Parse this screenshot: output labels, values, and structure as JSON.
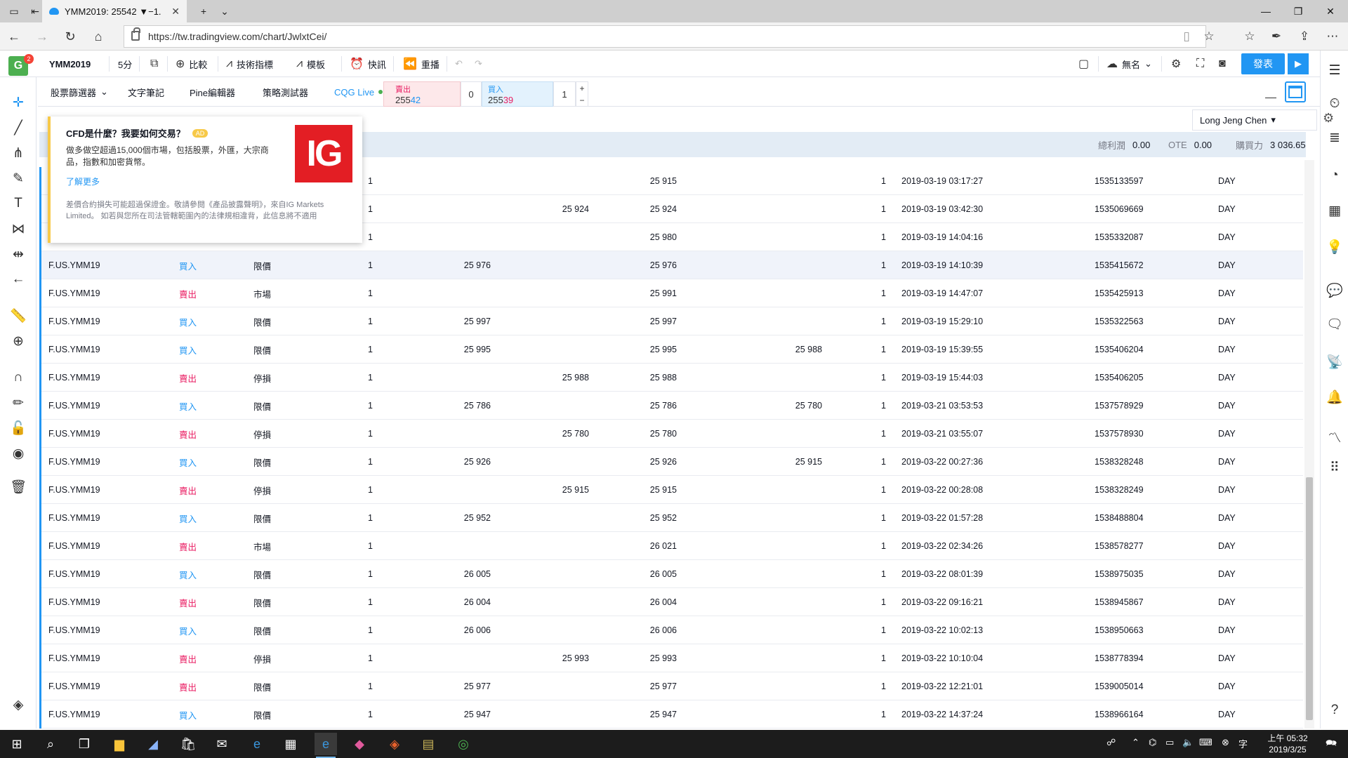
{
  "browser": {
    "tab_title": "YMM2019: 25542 ▼−1.",
    "url": "https://tw.tradingview.com/chart/JwlxtCei/"
  },
  "toolbar": {
    "symbol": "YMM2019",
    "interval": "5分",
    "compare": "比較",
    "indicators": "技術指標",
    "templates": "模板",
    "alert": "快訊",
    "replay": "重播",
    "layout_name": "無名",
    "publish": "發表"
  },
  "logo": {
    "letter": "G",
    "badge": "2"
  },
  "panel": {
    "tabs": [
      "股票篩選器",
      "文字筆記",
      "Pine編輯器",
      "策略測試器",
      "CQG Live"
    ],
    "sell_label": "賣出",
    "sell_price_a": "255",
    "sell_price_b": "42",
    "spread": "0",
    "buy_label": "買入",
    "buy_price_a": "255",
    "buy_price_b": "39",
    "qty": "1",
    "plus": "+",
    "minus": "−"
  },
  "account": {
    "name": "Long Jeng Chen",
    "total_pl_label": "總利潤",
    "total_pl": "0.00",
    "ote_label": "OTE",
    "ote": "0.00",
    "buying_power_label": "購買力",
    "buying_power": "3 036.65"
  },
  "ad": {
    "title": "CFD是什麼？我要如何交易？",
    "badge": "AD",
    "body": "做多做空超過15,000個市場，包括股票，外匯，大宗商品，指數和加密貨幣。",
    "link": "了解更多",
    "note": "差價合約損失可能超過保證金。敬請參閱《產品披露聲明》，來自IG Markets Limited。 如若與您所在司法管轄範圍內的法律規相違背，此信息將不適用",
    "logo_text": "IG"
  },
  "orders": [
    {
      "symbol": "",
      "side": "",
      "type": "",
      "qty": "1",
      "limit": "",
      "stop": "",
      "fill": "25 915",
      "tp": "",
      "fqty": "1",
      "time": "2019-03-19 03:17:27",
      "id": "1535133597",
      "tif": "DAY"
    },
    {
      "symbol": "",
      "side": "",
      "type": "",
      "qty": "1",
      "limit": "",
      "stop": "25 924",
      "fill": "25 924",
      "tp": "",
      "fqty": "1",
      "time": "2019-03-19 03:42:30",
      "id": "1535069669",
      "tif": "DAY"
    },
    {
      "symbol": "",
      "side": "",
      "type": "",
      "qty": "1",
      "limit": "",
      "stop": "",
      "fill": "25 980",
      "tp": "",
      "fqty": "1",
      "time": "2019-03-19 14:04:16",
      "id": "1535332087",
      "tif": "DAY"
    },
    {
      "symbol": "F.US.YMM19",
      "side": "買入",
      "type": "限價",
      "qty": "1",
      "limit": "25 976",
      "stop": "",
      "fill": "25 976",
      "tp": "",
      "fqty": "1",
      "time": "2019-03-19 14:10:39",
      "id": "1535415672",
      "tif": "DAY"
    },
    {
      "symbol": "F.US.YMM19",
      "side": "賣出",
      "type": "市場",
      "qty": "1",
      "limit": "",
      "stop": "",
      "fill": "25 991",
      "tp": "",
      "fqty": "1",
      "time": "2019-03-19 14:47:07",
      "id": "1535425913",
      "tif": "DAY"
    },
    {
      "symbol": "F.US.YMM19",
      "side": "買入",
      "type": "限價",
      "qty": "1",
      "limit": "25 997",
      "stop": "",
      "fill": "25 997",
      "tp": "",
      "fqty": "1",
      "time": "2019-03-19 15:29:10",
      "id": "1535322563",
      "tif": "DAY"
    },
    {
      "symbol": "F.US.YMM19",
      "side": "買入",
      "type": "限價",
      "qty": "1",
      "limit": "25 995",
      "stop": "",
      "fill": "25 995",
      "tp": "25 988",
      "fqty": "1",
      "time": "2019-03-19 15:39:55",
      "id": "1535406204",
      "tif": "DAY"
    },
    {
      "symbol": "F.US.YMM19",
      "side": "賣出",
      "type": "停損",
      "qty": "1",
      "limit": "",
      "stop": "25 988",
      "fill": "25 988",
      "tp": "",
      "fqty": "1",
      "time": "2019-03-19 15:44:03",
      "id": "1535406205",
      "tif": "DAY"
    },
    {
      "symbol": "F.US.YMM19",
      "side": "買入",
      "type": "限價",
      "qty": "1",
      "limit": "25 786",
      "stop": "",
      "fill": "25 786",
      "tp": "25 780",
      "fqty": "1",
      "time": "2019-03-21 03:53:53",
      "id": "1537578929",
      "tif": "DAY"
    },
    {
      "symbol": "F.US.YMM19",
      "side": "賣出",
      "type": "停損",
      "qty": "1",
      "limit": "",
      "stop": "25 780",
      "fill": "25 780",
      "tp": "",
      "fqty": "1",
      "time": "2019-03-21 03:55:07",
      "id": "1537578930",
      "tif": "DAY"
    },
    {
      "symbol": "F.US.YMM19",
      "side": "買入",
      "type": "限價",
      "qty": "1",
      "limit": "25 926",
      "stop": "",
      "fill": "25 926",
      "tp": "25 915",
      "fqty": "1",
      "time": "2019-03-22 00:27:36",
      "id": "1538328248",
      "tif": "DAY"
    },
    {
      "symbol": "F.US.YMM19",
      "side": "賣出",
      "type": "停損",
      "qty": "1",
      "limit": "",
      "stop": "25 915",
      "fill": "25 915",
      "tp": "",
      "fqty": "1",
      "time": "2019-03-22 00:28:08",
      "id": "1538328249",
      "tif": "DAY"
    },
    {
      "symbol": "F.US.YMM19",
      "side": "買入",
      "type": "限價",
      "qty": "1",
      "limit": "25 952",
      "stop": "",
      "fill": "25 952",
      "tp": "",
      "fqty": "1",
      "time": "2019-03-22 01:57:28",
      "id": "1538488804",
      "tif": "DAY"
    },
    {
      "symbol": "F.US.YMM19",
      "side": "賣出",
      "type": "市場",
      "qty": "1",
      "limit": "",
      "stop": "",
      "fill": "26 021",
      "tp": "",
      "fqty": "1",
      "time": "2019-03-22 02:34:26",
      "id": "1538578277",
      "tif": "DAY"
    },
    {
      "symbol": "F.US.YMM19",
      "side": "買入",
      "type": "限價",
      "qty": "1",
      "limit": "26 005",
      "stop": "",
      "fill": "26 005",
      "tp": "",
      "fqty": "1",
      "time": "2019-03-22 08:01:39",
      "id": "1538975035",
      "tif": "DAY"
    },
    {
      "symbol": "F.US.YMM19",
      "side": "賣出",
      "type": "限價",
      "qty": "1",
      "limit": "26 004",
      "stop": "",
      "fill": "26 004",
      "tp": "",
      "fqty": "1",
      "time": "2019-03-22 09:16:21",
      "id": "1538945867",
      "tif": "DAY"
    },
    {
      "symbol": "F.US.YMM19",
      "side": "買入",
      "type": "限價",
      "qty": "1",
      "limit": "26 006",
      "stop": "",
      "fill": "26 006",
      "tp": "",
      "fqty": "1",
      "time": "2019-03-22 10:02:13",
      "id": "1538950663",
      "tif": "DAY"
    },
    {
      "symbol": "F.US.YMM19",
      "side": "賣出",
      "type": "停損",
      "qty": "1",
      "limit": "",
      "stop": "25 993",
      "fill": "25 993",
      "tp": "",
      "fqty": "1",
      "time": "2019-03-22 10:10:04",
      "id": "1538778394",
      "tif": "DAY"
    },
    {
      "symbol": "F.US.YMM19",
      "side": "賣出",
      "type": "限價",
      "qty": "1",
      "limit": "25 977",
      "stop": "",
      "fill": "25 977",
      "tp": "",
      "fqty": "1",
      "time": "2019-03-22 12:21:01",
      "id": "1539005014",
      "tif": "DAY"
    },
    {
      "symbol": "F.US.YMM19",
      "side": "買入",
      "type": "限價",
      "qty": "1",
      "limit": "25 947",
      "stop": "",
      "fill": "25 947",
      "tp": "",
      "fqty": "1",
      "time": "2019-03-22 14:37:24",
      "id": "1538966164",
      "tif": "DAY"
    }
  ],
  "taskbar": {
    "time": "上午 05:32",
    "date": "2019/3/25"
  },
  "colors": {
    "accent": "#2196f3",
    "sell": "#e91e63",
    "buy": "#2196f3"
  }
}
